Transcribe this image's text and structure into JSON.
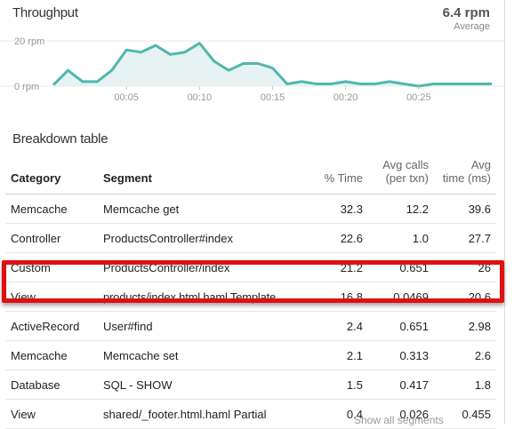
{
  "throughput": {
    "title": "Throughput",
    "average_value": "6.4 rpm",
    "average_label": "Average"
  },
  "chart_data": {
    "type": "area",
    "title": "Throughput",
    "y_ticks": [
      "20 rpm",
      "0 rpm"
    ],
    "x_ticks": [
      "00:05",
      "00:10",
      "00:15",
      "00:20",
      "00:25"
    ],
    "ylim": [
      0,
      20
    ],
    "xlim": [
      0,
      30
    ],
    "x": [
      0,
      1,
      2,
      3,
      4,
      5,
      6,
      7,
      8,
      9,
      10,
      11,
      12,
      13,
      14,
      15,
      16,
      17,
      18,
      19,
      20,
      21,
      22,
      23,
      24,
      25,
      26,
      27,
      28,
      29,
      30
    ],
    "series": [
      {
        "values": [
          0.5,
          7,
          2,
          2,
          7,
          16,
          15,
          18,
          14,
          15,
          19,
          11,
          7,
          10,
          10,
          8,
          1,
          2,
          1,
          1,
          2,
          1,
          1,
          2,
          1,
          0,
          1,
          1,
          1,
          1,
          1
        ]
      }
    ],
    "colors": {
      "line": "#4fb8ac",
      "fill": "#e6f3f2",
      "grid": "#e8e8e8"
    },
    "grid": true
  },
  "breakdown": {
    "title": "Breakdown table",
    "headers": {
      "category": "Category",
      "segment": "Segment",
      "pct_time": "% Time",
      "avg_calls_line1": "Avg calls",
      "avg_calls_line2": "(per txn)",
      "avg_time_line1": "Avg",
      "avg_time_line2": "time (ms)"
    },
    "rows": [
      {
        "category": "Memcache",
        "segment": "Memcache get",
        "pct_time": "32.3",
        "avg_calls": "12.2",
        "avg_time": "39.6"
      },
      {
        "category": "Controller",
        "segment": "ProductsController#index",
        "pct_time": "22.6",
        "avg_calls": "1.0",
        "avg_time": "27.7"
      },
      {
        "category": "Custom",
        "segment": "ProductsController/index",
        "pct_time": "21.2",
        "avg_calls": "0.651",
        "avg_time": "26"
      },
      {
        "category": "View",
        "segment": "products/index.html.haml Template",
        "pct_time": "16.8",
        "avg_calls": "0.0469",
        "avg_time": "20.6"
      },
      {
        "category": "ActiveRecord",
        "segment": "User#find",
        "pct_time": "2.4",
        "avg_calls": "0.651",
        "avg_time": "2.98"
      },
      {
        "category": "Memcache",
        "segment": "Memcache set",
        "pct_time": "2.1",
        "avg_calls": "0.313",
        "avg_time": "2.6"
      },
      {
        "category": "Database",
        "segment": "SQL - SHOW",
        "pct_time": "1.5",
        "avg_calls": "0.417",
        "avg_time": "1.8"
      },
      {
        "category": "View",
        "segment": "shared/_footer.html.haml Partial",
        "pct_time": "0.4",
        "avg_calls": "0.026",
        "avg_time": "0.455"
      }
    ],
    "highlight_color": "#e01010",
    "footer_link": "Show all segments"
  }
}
